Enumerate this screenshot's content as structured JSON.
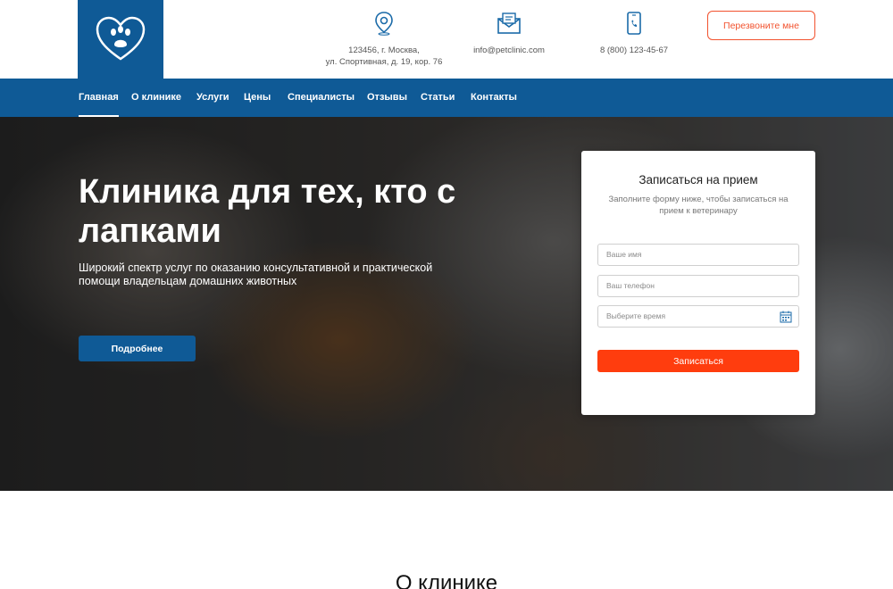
{
  "header": {
    "logo": "heart-paw-logo",
    "address_line1": "123456, г. Москва,",
    "address_line2": "ул. Спортивная, д. 19, кор. 76",
    "email": "info@petclinic.com",
    "phone": "8 (800) 123-45-67",
    "callback_label": "Перезвоните мне",
    "icons": [
      "location-pin-icon",
      "mail-icon",
      "phone-icon"
    ]
  },
  "nav": {
    "items": [
      "Главная",
      "О клинике",
      "Услуги",
      "Цены",
      "Специалисты",
      "Отзывы",
      "Статьи",
      "Контакты"
    ],
    "active": "Главная"
  },
  "hero": {
    "title": "Клиника для тех, кто с лапками",
    "subtitle": "Широкий спектр услуг по оказанию консультативной и практической помощи владельцам домашних животных",
    "button_label": "Подробнее"
  },
  "form": {
    "title": "Записаться на прием",
    "subtitle": "Заполните форму ниже, чтобы записаться на прием к ветеринару",
    "name_placeholder": "Ваше имя",
    "phone_placeholder": "Ваш телефон",
    "time_placeholder": "Выберите время",
    "submit_label": "Записаться"
  },
  "about": {
    "title": "О клинике"
  },
  "colors": {
    "primary": "#0f5a96",
    "accent": "#ff3d0e",
    "callback_border": "#f2522e"
  }
}
